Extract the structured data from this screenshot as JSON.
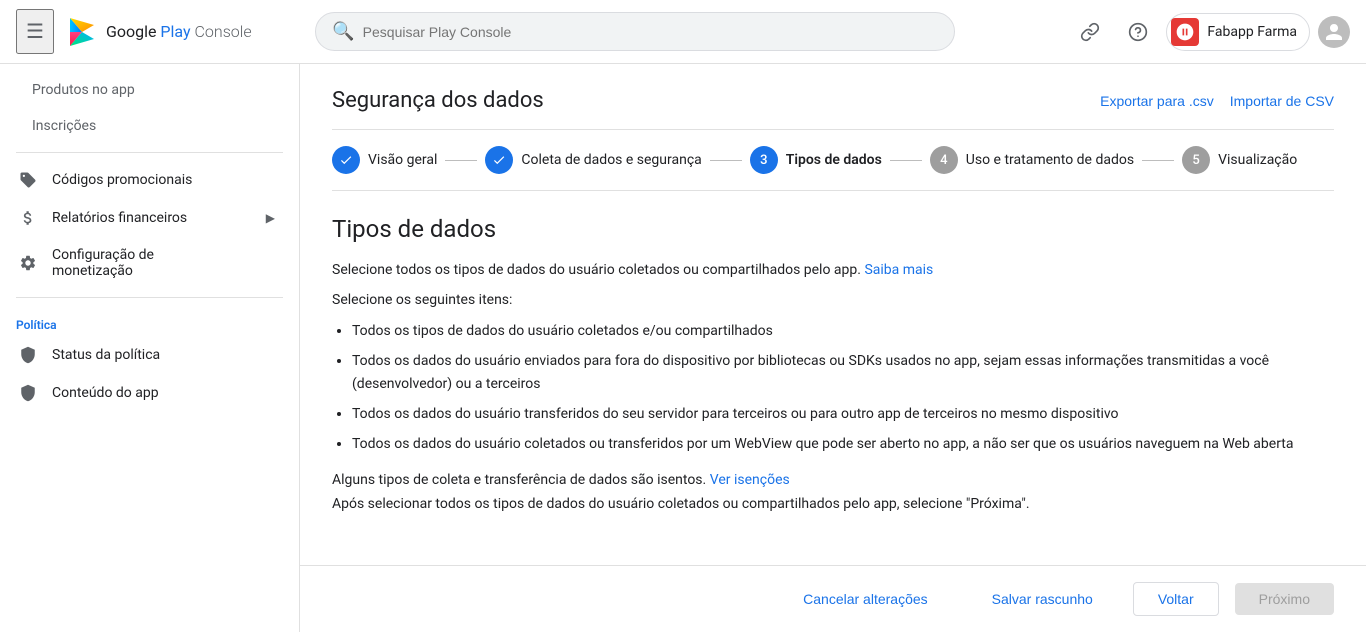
{
  "header": {
    "hamburger_label": "☰",
    "logo_text": "Google Play Console",
    "search_placeholder": "Pesquisar Play Console",
    "link_icon": "🔗",
    "help_icon": "?",
    "account_name": "Fabapp Farma",
    "avatar_icon": "👤"
  },
  "sidebar": {
    "items": [
      {
        "id": "produtos-no-app",
        "label": "Produtos no app",
        "icon": "",
        "sub": true,
        "active": false
      },
      {
        "id": "inscricoes",
        "label": "Inscrições",
        "icon": "",
        "sub": true,
        "active": false
      },
      {
        "id": "codigos-promocionais",
        "label": "Códigos promocionais",
        "icon": "🏷",
        "sub": false,
        "active": false
      },
      {
        "id": "relatorios-financeiros",
        "label": "Relatórios financeiros",
        "icon": "$",
        "sub": false,
        "active": false,
        "expand": true
      },
      {
        "id": "configuracao-de-monetizacao",
        "label": "Configuração de monetização",
        "icon": "⚙",
        "sub": false,
        "active": false
      }
    ],
    "politica_label": "Política",
    "politica_items": [
      {
        "id": "status-da-politica",
        "label": "Status da política",
        "icon": "🛡"
      },
      {
        "id": "conteudo-do-app",
        "label": "Conteúdo do app",
        "icon": "🛡"
      }
    ]
  },
  "content": {
    "page_title": "Segurança dos dados",
    "export_btn": "Exportar para .csv",
    "import_btn": "Importar de CSV",
    "stepper": {
      "steps": [
        {
          "id": "visao-geral",
          "number": "✓",
          "label": "Visão geral",
          "state": "done"
        },
        {
          "id": "coleta-dados",
          "number": "✓",
          "label": "Coleta de dados e segurança",
          "state": "done"
        },
        {
          "id": "tipos-de-dados",
          "number": "3",
          "label": "Tipos de dados",
          "state": "active"
        },
        {
          "id": "uso-tratamento",
          "number": "4",
          "label": "Uso e tratamento de dados",
          "state": "inactive"
        },
        {
          "id": "visualizacao",
          "number": "5",
          "label": "Visualização",
          "state": "inactive"
        }
      ]
    },
    "section_title": "Tipos de dados",
    "desc1": "Selecione todos os tipos de dados do usuário coletados ou compartilhados pelo app.",
    "saiba_mais_link": "Saiba mais",
    "desc2": "Selecione os seguintes itens:",
    "bullets": [
      "Todos os tipos de dados do usuário coletados e/ou compartilhados",
      "Todos os dados do usuário enviados para fora do dispositivo por bibliotecas ou SDKs usados no app, sejam essas informações transmitidas a você (desenvolvedor) ou a terceiros",
      "Todos os dados do usuário transferidos do seu servidor para terceiros ou para outro app de terceiros no mesmo dispositivo",
      "Todos os dados do usuário coletados ou transferidos por um WebView que pode ser aberto no app, a não ser que os usuários naveguem na Web aberta"
    ],
    "exemptions_text": "Alguns tipos de coleta e transferência de dados são isentos.",
    "ver_isencoes_link": "Ver isenções",
    "after_select_text": "Após selecionar todos os tipos de dados do usuário coletados ou compartilhados pelo app, selecione \"Próxima\".",
    "bottom_bar": {
      "cancelar_label": "Cancelar alterações",
      "salvar_label": "Salvar rascunho",
      "voltar_label": "Voltar",
      "proximo_label": "Próximo"
    }
  }
}
